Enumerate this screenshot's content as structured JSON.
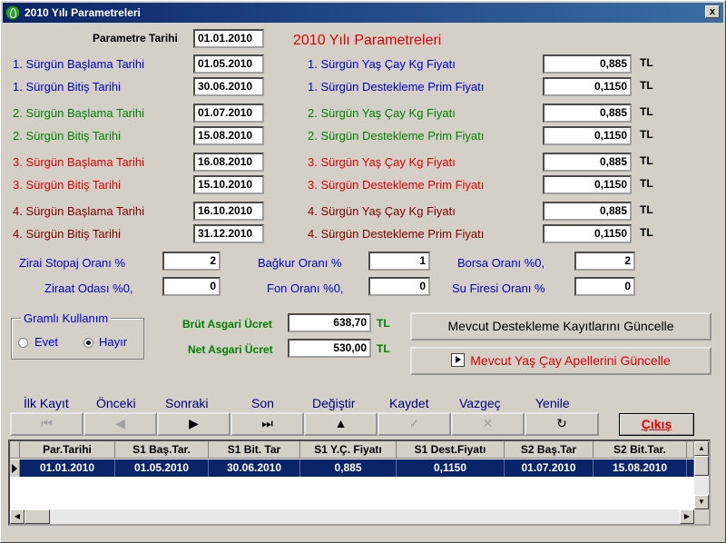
{
  "window": {
    "title": "2010 Yılı Parametreleri",
    "close_label": "x"
  },
  "heading": "2010 Yılı Parametreleri",
  "param_date": {
    "label": "Parametre Tarihi",
    "value": "01.01.2010"
  },
  "currency": "TL",
  "sprouts": [
    {
      "start_label": "1. Sürgün Başlama Tarihi",
      "start_value": "01.05.2010",
      "end_label": "1. Sürgün Bitiş Tarihi",
      "end_value": "30.06.2010",
      "price_label": "1. Sürgün Yaş Çay Kg Fiyatı",
      "price_value": "0,885",
      "premium_label": "1. Sürgün Destekleme Prim Fiyatı",
      "premium_value": "0,1150",
      "color": "#0000cc"
    },
    {
      "start_label": "2. Sürgün Başlama Tarihi",
      "start_value": "01.07.2010",
      "end_label": "2. Sürgün Bitiş Tarihi",
      "end_value": "15.08.2010",
      "price_label": "2. Sürgün Yaş Çay Kg Fiyatı",
      "price_value": "0,885",
      "premium_label": "2. Sürgün Destekleme Prim Fiyatı",
      "premium_value": "0,1150",
      "color": "#008000"
    },
    {
      "start_label": "3. Sürgün Başlama Tarihi",
      "start_value": "16.08.2010",
      "end_label": "3. Sürgün Bitiş Tarihi",
      "end_value": "15.10.2010",
      "price_label": "3. Sürgün Yaş Çay Kg Fiyatı",
      "price_value": "0,885",
      "premium_label": "3. Sürgün Destekleme Prim Fiyatı",
      "premium_value": "0,1150",
      "color": "#e00000"
    },
    {
      "start_label": "4. Sürgün Başlama Tarihi",
      "start_value": "16.10.2010",
      "end_label": "4. Sürgün Bitiş Tarihi",
      "end_value": "31.12.2010",
      "price_label": "4. Sürgün Yaş Çay Kg Fiyatı",
      "price_value": "0,885",
      "premium_label": "4. Sürgün Destekleme Prim Fiyatı",
      "premium_value": "0,1150",
      "color": "#800000"
    }
  ],
  "rates": {
    "zirai_stopaj": {
      "label": "Zirai Stopaj Oranı %",
      "value": "2"
    },
    "bagkur": {
      "label": "Bağkur Oranı %",
      "value": "1"
    },
    "borsa": {
      "label": "Borsa Oranı %0,",
      "value": "2"
    },
    "ziraat_odasi": {
      "label": "Ziraat Odası %0,",
      "value": "0"
    },
    "fon": {
      "label": "Fon Oranı %0,",
      "value": "0"
    },
    "su_firesi": {
      "label": "Su Firesi Oranı %",
      "value": "0"
    }
  },
  "gram_usage": {
    "legend": "Gramlı Kullanım",
    "yes": "Evet",
    "no": "Hayır",
    "selected": "Hayır"
  },
  "wages": {
    "gross_label": "Brüt Asgari Ücret",
    "gross_value": "638,70",
    "net_label": "Net Asgari Ücret",
    "net_value": "530,00"
  },
  "actions": {
    "update_support": "Mevcut Destekleme Kayıtlarını Güncelle",
    "update_appeals": "Mevcut Yaş Çay Apellerini Güncelle"
  },
  "nav": [
    {
      "label": "İlk Kayıt",
      "glyph": "⏮",
      "enabled": false
    },
    {
      "label": "Önceki",
      "glyph": "◀",
      "enabled": false
    },
    {
      "label": "Sonraki",
      "glyph": "▶",
      "enabled": true
    },
    {
      "label": "Son",
      "glyph": "⏭",
      "enabled": true
    },
    {
      "label": "Değiştir",
      "glyph": "▲",
      "enabled": true
    },
    {
      "label": "Kaydet",
      "glyph": "✓",
      "enabled": false
    },
    {
      "label": "Vazgeç",
      "glyph": "✕",
      "enabled": false
    },
    {
      "label": "Yenile",
      "glyph": "↻",
      "enabled": true
    }
  ],
  "exit_label": "Çıkış",
  "grid": {
    "columns": [
      "Par.Tarihi",
      "S1 Baş.Tar.",
      "S1 Bit. Tar",
      "S1 Y.Ç. Fiyatı",
      "S1 Dest.Fiyatı",
      "S2 Baş.Tar",
      "S2 Bit.Tar."
    ],
    "rows": [
      [
        "01.01.2010",
        "01.05.2010",
        "30.06.2010",
        "0,885",
        "0,1150",
        "01.07.2010",
        "15.08.2010"
      ]
    ]
  }
}
